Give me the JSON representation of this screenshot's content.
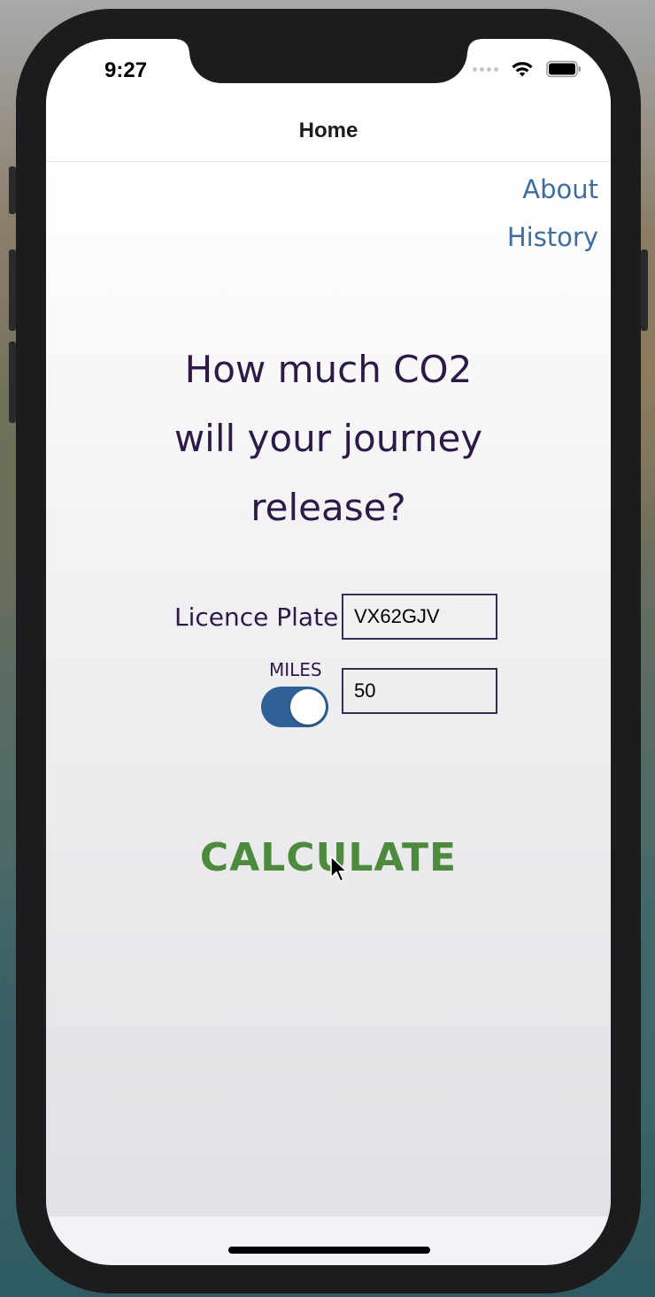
{
  "status_bar": {
    "time": "9:27"
  },
  "navbar": {
    "title": "Home"
  },
  "links": {
    "about": "About",
    "history": "History"
  },
  "headline": {
    "line1": "How much CO2",
    "line2": "will your journey",
    "line3": "release?"
  },
  "form": {
    "plate_label": "Licence Plate",
    "plate_value": "VX62GJV",
    "miles_label": "MILES",
    "miles_toggle_on": true,
    "distance_value": "50"
  },
  "action": {
    "calculate_label": "CALCULATE"
  },
  "colors": {
    "heading": "#2e1a47",
    "link": "#3d6e9e",
    "toggle_on": "#2f6196",
    "calculate": "#4e8a3e"
  }
}
